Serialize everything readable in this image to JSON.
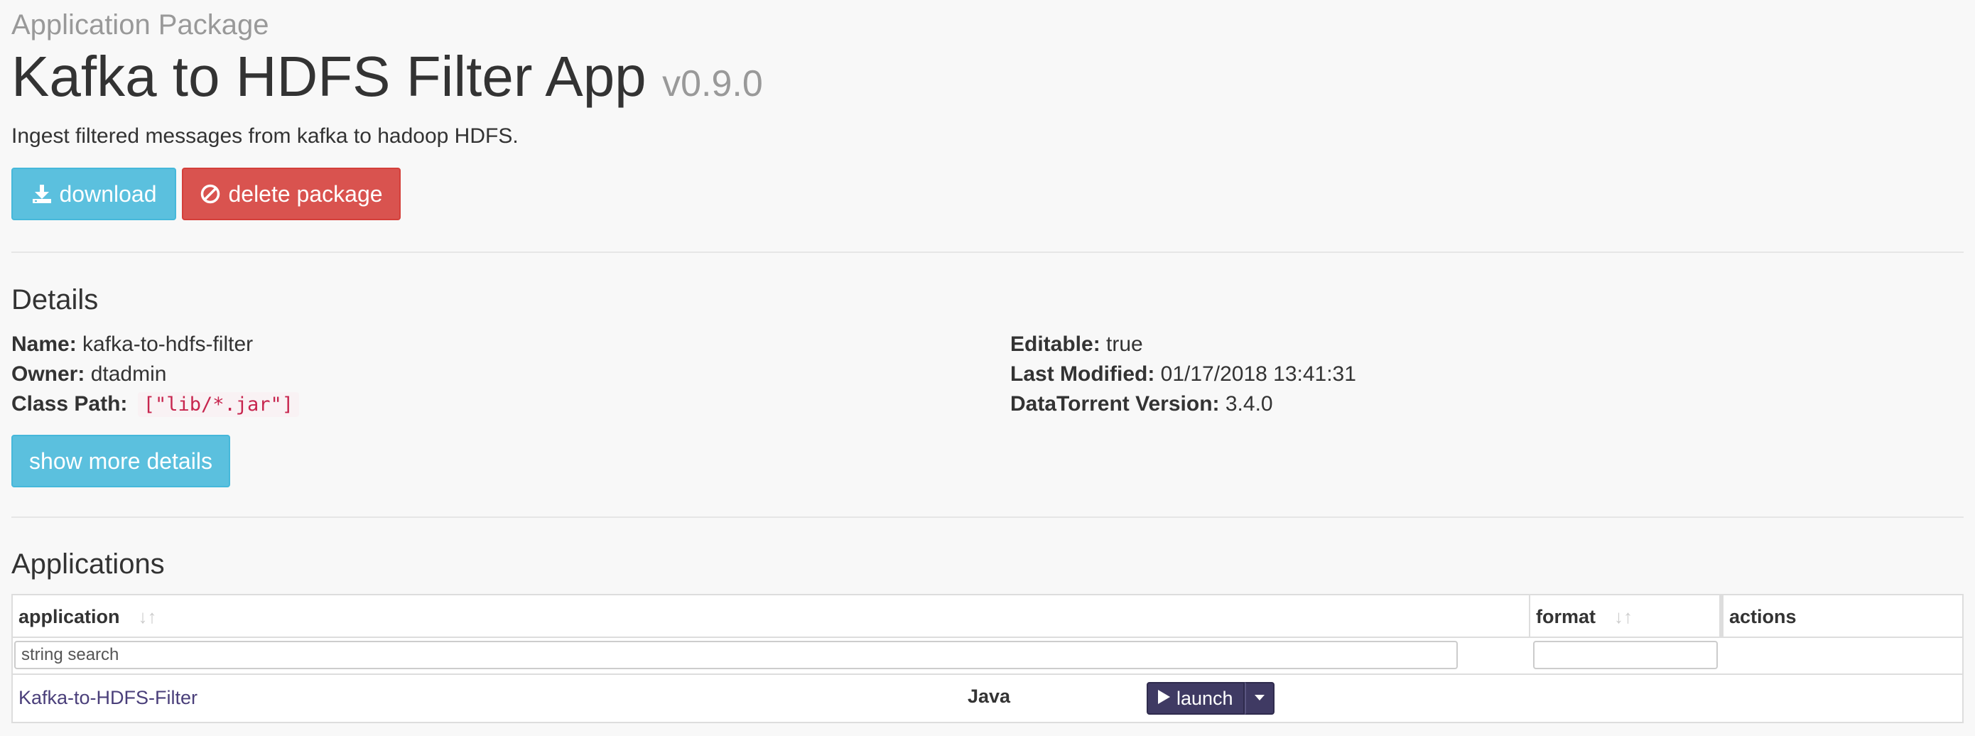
{
  "header": {
    "subtitle": "Application Package",
    "title": "Kafka to HDFS Filter App",
    "version": "v0.9.0",
    "description": "Ingest filtered messages from kafka to hadoop HDFS."
  },
  "actions": {
    "download_label": "download",
    "delete_label": "delete package"
  },
  "details": {
    "heading": "Details",
    "name_label": "Name:",
    "name_value": "kafka-to-hdfs-filter",
    "owner_label": "Owner:",
    "owner_value": "dtadmin",
    "classpath_label": "Class Path:",
    "classpath_value": "[\"lib/*.jar\"]",
    "editable_label": "Editable:",
    "editable_value": "true",
    "modified_label": "Last Modified:",
    "modified_value": "01/17/2018 13:41:31",
    "dt_version_label": "DataTorrent Version:",
    "dt_version_value": "3.4.0",
    "more_button_label": "show more details"
  },
  "applications": {
    "heading": "Applications",
    "columns": [
      "application",
      "format",
      "actions"
    ],
    "search_placeholder": "string search",
    "format_filter_value": "",
    "rows": [
      {
        "application": "Kafka-to-HDFS-Filter",
        "format": "Java",
        "action_label": "launch"
      }
    ]
  },
  "colors": {
    "background": "#f8f8f8",
    "info": "#5bc0de",
    "danger": "#d9534f",
    "launch": "#3f3a63",
    "link": "#4a3f7a",
    "code": "#c7254e"
  },
  "icons": {
    "download": "download-icon",
    "delete": "ban-icon",
    "sort": "sort-icon",
    "launch": "play-icon",
    "dropdown": "caret-down-icon"
  }
}
